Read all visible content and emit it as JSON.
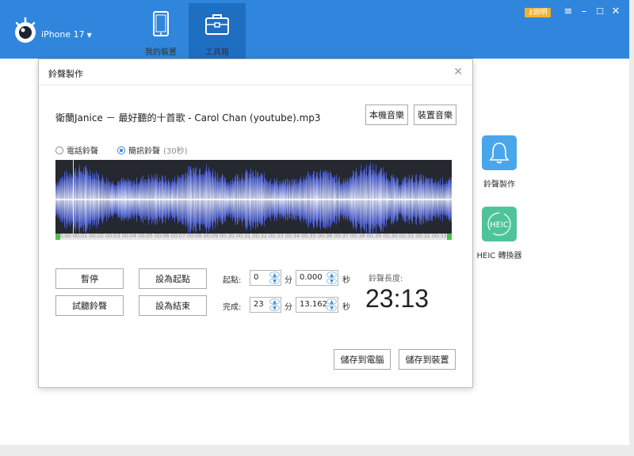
{
  "topbar": {
    "device_name": "iPhone 17",
    "nav": [
      {
        "label": "我的裝置"
      },
      {
        "label": "工具箱"
      }
    ],
    "help_label": "說明",
    "accent": "#2f86dc",
    "active_tab": "#1e6fc2"
  },
  "tools": [
    {
      "label": "鈴聲製作",
      "icon": "bell-icon",
      "color": "#4aa6ea"
    },
    {
      "label": "HEIC 轉換器",
      "icon": "heic-icon",
      "tile_text": "HEIC",
      "color": "#4fc49a"
    }
  ],
  "dialog": {
    "title": "鈴聲製作",
    "song": "衛蘭Janice － 最好聽的十首歌 - Carol Chan (youtube).mp3",
    "local_music_label": "本機音樂",
    "device_music_label": "裝置音樂",
    "radio_phone": "電話鈴聲",
    "radio_message": "簡訊鈴聲",
    "radio_message_note": "(30秒)",
    "selected_radio": "message",
    "timeline_ticks": "00:00 00:01 00:02 00:03 00:04 00:05 00:06 00:07 00:08 00:09 00:30 00:31 00:32 00:33 00:34 00:35 00:36 00:37 00:38 00:39 00:30 00:31 00:32 00:33 00:38",
    "pause_label": "暫停",
    "preview_label": "試聽鈴聲",
    "set_start_label": "設為起點",
    "set_end_label": "設為結束",
    "start_label": "起點:",
    "end_label": "完成:",
    "minute_unit": "分",
    "second_unit": "秒",
    "start_min": "0",
    "start_sec": "0.000",
    "end_min": "23",
    "end_sec": "13.162",
    "length_label": "鈴聲長度:",
    "length_value": "23:13",
    "save_pc_label": "儲存到電腦",
    "save_device_label": "儲存到裝置"
  }
}
